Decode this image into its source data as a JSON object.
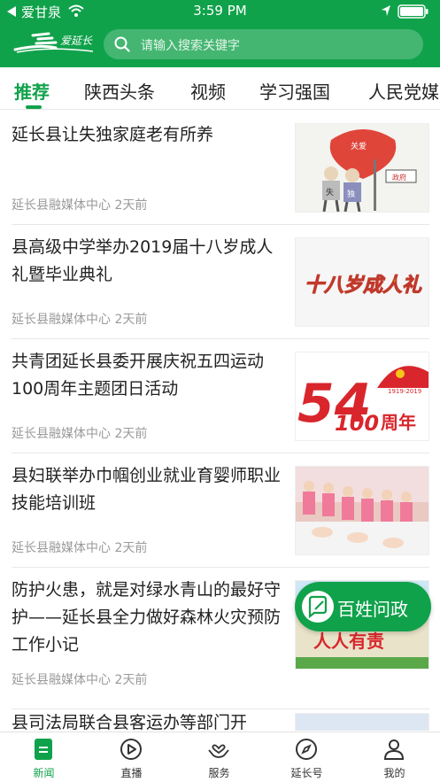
{
  "status_bar": {
    "carrier": "爱甘泉",
    "time": "3:59 PM"
  },
  "header": {
    "logo_text": "爱延长",
    "search_placeholder": "请输入搜索关键字"
  },
  "tabs": [
    {
      "label": "推荐",
      "active": true
    },
    {
      "label": "陕西头条",
      "active": false
    },
    {
      "label": "视频",
      "active": false
    },
    {
      "label": "学习强国",
      "active": false
    },
    {
      "label": "人民党媒",
      "active": false
    }
  ],
  "articles": [
    {
      "title": "延长县让失独家庭老有所养",
      "source": "延长县融媒体中心",
      "time": "2天前"
    },
    {
      "title": "县高级中学举办2019届十八岁成人礼暨毕业典礼",
      "source": "延长县融媒体中心",
      "time": "2天前"
    },
    {
      "title": "共青团延长县委开展庆祝五四运动100周年主题团日活动",
      "source": "延长县融媒体中心",
      "time": "2天前"
    },
    {
      "title": "县妇联举办巾帼创业就业育婴师职业技能培训班",
      "source": "延长县融媒体中心",
      "time": "2天前"
    },
    {
      "title": "防护火患，就是对绿水青山的最好守护——延长县全力做好森林火灾预防工作小记",
      "source": "延长县融媒体中心",
      "time": "2天前"
    },
    {
      "title": "县司法局联合县客运办等部门开",
      "source": "",
      "time": ""
    }
  ],
  "thumb_text": {
    "t1_heart": "关爱",
    "t1_fig1": "失",
    "t1_fig2": "独",
    "t1_gov": "政府",
    "t2_text": "十八岁成人礼",
    "t3_big": "54",
    "t3_years": "1919-2019",
    "t3_hundred": "100",
    "t3_suffix": "周年",
    "t5_text": "人人有责"
  },
  "float_button": {
    "label": "百姓问政"
  },
  "bottom_nav": [
    {
      "label": "新闻",
      "icon": "news-icon",
      "active": true
    },
    {
      "label": "直播",
      "icon": "live-play-icon",
      "active": false
    },
    {
      "label": "服务",
      "icon": "service-heart-hand-icon",
      "active": false
    },
    {
      "label": "延长号",
      "icon": "compass-icon",
      "active": false
    },
    {
      "label": "我的",
      "icon": "person-icon",
      "active": false
    }
  ],
  "colors": {
    "brand_green": "#10a24b",
    "meta_gray": "#9a9a9a",
    "text": "#222222"
  }
}
